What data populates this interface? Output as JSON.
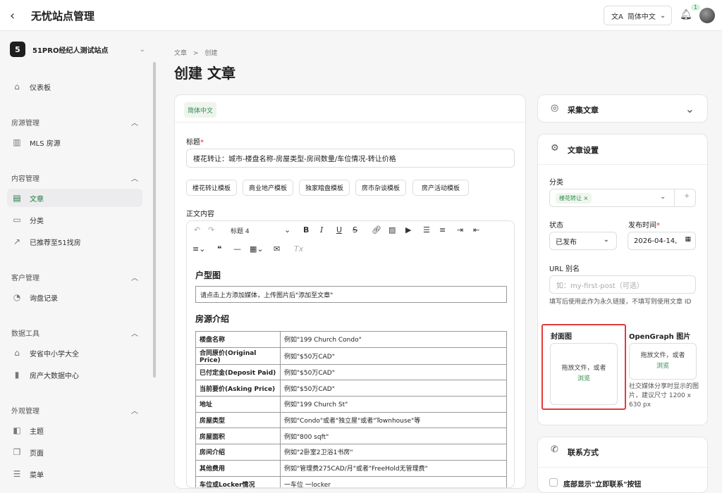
{
  "app": {
    "title": "无忧站点管理",
    "language": "简体中文",
    "notification_count": "1"
  },
  "sidebar": {
    "site_badge": "5",
    "site_name": "51PRO经纪人测试站点",
    "dashboard": "仪表板",
    "sections": [
      {
        "label": "房源管理",
        "items": [
          "MLS 房源"
        ]
      },
      {
        "label": "内容管理",
        "items": [
          "文章",
          "分类",
          "已推荐至51找房"
        ]
      },
      {
        "label": "客户管理",
        "items": [
          "询盘记录"
        ]
      },
      {
        "label": "数据工具",
        "items": [
          "安省中小学大全",
          "房产大数据中心"
        ]
      },
      {
        "label": "外观管理",
        "items": [
          "主题",
          "页面",
          "菜单"
        ]
      }
    ]
  },
  "main": {
    "breadcrumb": {
      "parent": "文章",
      "sep": ">",
      "current": "创建"
    },
    "page_title": "创建 文章",
    "lang_tab": "简体中文",
    "title_label": "标题",
    "title_value": "楼花转让：城市-楼盘名称-房屋类型-房间数量/车位情况-转让价格",
    "templates": [
      "楼花转让模板",
      "商业地产模板",
      "独家暗盘模板",
      "房市杂谈模板",
      "房产活动模板"
    ],
    "body_label": "正文内容",
    "heading_select": "标题 4",
    "doc": {
      "h1": "户型图",
      "note": "请点击上方添加媒体，上传图片后\"添加至文章\"",
      "h2": "房源介绍",
      "rows": [
        [
          "楼盘名称",
          "例如\"199 Church Condo\""
        ],
        [
          "合同原价(Original Price)",
          "例如\"$50万CAD\""
        ],
        [
          "已付定金(Deposit Paid)",
          "例如\"$50万CAD\""
        ],
        [
          "当前要价(Asking Price)",
          "例如\"$50万CAD\""
        ],
        [
          "地址",
          "例如\"199 Church St\""
        ],
        [
          "房屋类型",
          "例如\"Condo\"或者\"独立屋\"或者\"Townhouse\"等"
        ],
        [
          "房屋面积",
          "例如\"800 sqft\""
        ],
        [
          "房间介绍",
          "例如\"2卧室2卫浴1书房\""
        ],
        [
          "其他费用",
          "例如\"管理费275CAD/月\"或者\"FreeHold无管理费\""
        ],
        [
          "车位或Locker情况",
          "一车位 一locker"
        ]
      ]
    }
  },
  "right": {
    "collect": "采集文章",
    "settings": "文章设置",
    "category_label": "分类",
    "category_tag": "楼花转让",
    "status_label": "状态",
    "status_value": "已发布",
    "publish_label": "发布时间",
    "publish_value": "2026-04-14,",
    "slug_label": "URL 别名",
    "slug_placeholder": "如：my-first-post（可选）",
    "slug_help": "填写后使用此作为永久链接，不填写则使用文章 ID",
    "cover_label": "封面图",
    "og_label": "OpenGraph 图片",
    "drop_text": "拖放文件，或者",
    "browse": "浏览",
    "og_help": "社交媒体分享时显示的图片，建议尺寸 1200 x 630 px",
    "contact": "联系方式",
    "contact_option": "底部显示\"立即联系\"按钮"
  }
}
